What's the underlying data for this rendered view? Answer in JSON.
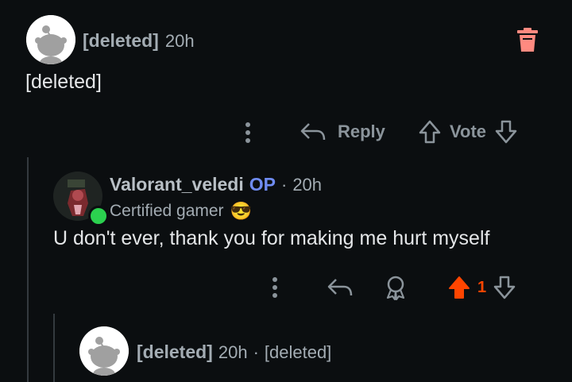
{
  "comment1": {
    "username": "[deleted]",
    "time": "20h",
    "body": "[deleted]",
    "reply_label": "Reply",
    "vote_label": "Vote",
    "delete_icon_color": "#ff8a80"
  },
  "comment2": {
    "username": "Valorant_veledi",
    "op_badge": "OP",
    "separator": "·",
    "time": "20h",
    "flair": "Certified gamer",
    "flair_emoji": "😎",
    "body": "U don't ever, thank you for making me hurt myself",
    "score": "1",
    "online_color": "#2bd14f",
    "upvote_color": "#ff4500"
  },
  "comment3": {
    "username": "[deleted]",
    "time": "20h",
    "separator": "·",
    "body_inline": "[deleted]"
  }
}
